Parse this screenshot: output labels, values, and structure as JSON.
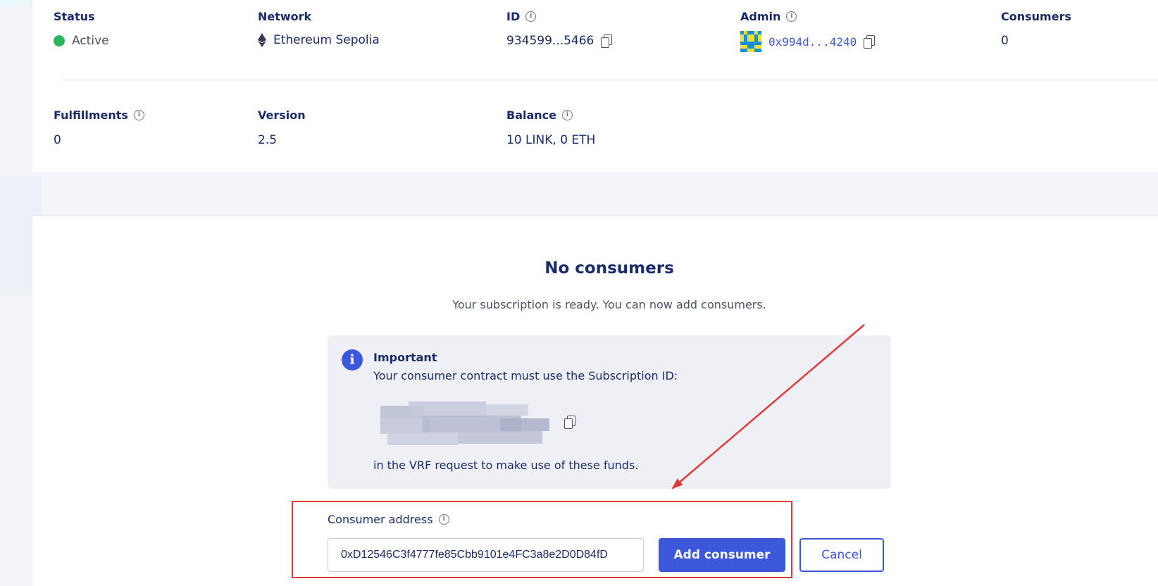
{
  "details": {
    "status": {
      "label": "Status",
      "value": "Active"
    },
    "network": {
      "label": "Network",
      "value": "Ethereum Sepolia"
    },
    "id": {
      "label": "ID",
      "value": "934599...5466"
    },
    "admin": {
      "label": "Admin",
      "value": "0x994d...4240"
    },
    "consumers": {
      "label": "Consumers",
      "value": "0"
    },
    "fulfillments": {
      "label": "Fulfillments",
      "value": "0"
    },
    "version": {
      "label": "Version",
      "value": "2.5"
    },
    "balance": {
      "label": "Balance",
      "value": "10 LINK, 0 ETH"
    }
  },
  "empty_state": {
    "title": "No consumers",
    "subtitle": "Your subscription is ready. You can now add consumers."
  },
  "notice": {
    "title": "Important",
    "text": "Your consumer contract must use the Subscription ID:",
    "footer": "in the VRF request to make use of these funds."
  },
  "form": {
    "label": "Consumer address",
    "address_value": "0xD12546C3f4777fe85Cbb9101e4FC3a8e2D0D84fD",
    "add_label": "Add consumer",
    "cancel_label": "Cancel"
  },
  "colors": {
    "status_active": "#2fb560",
    "primary": "#3c57d9",
    "annotation": "#e03a3a"
  },
  "icons": [
    "info-icon",
    "copy-icon",
    "ethereum-icon",
    "status-dot",
    "admin-avatar"
  ]
}
